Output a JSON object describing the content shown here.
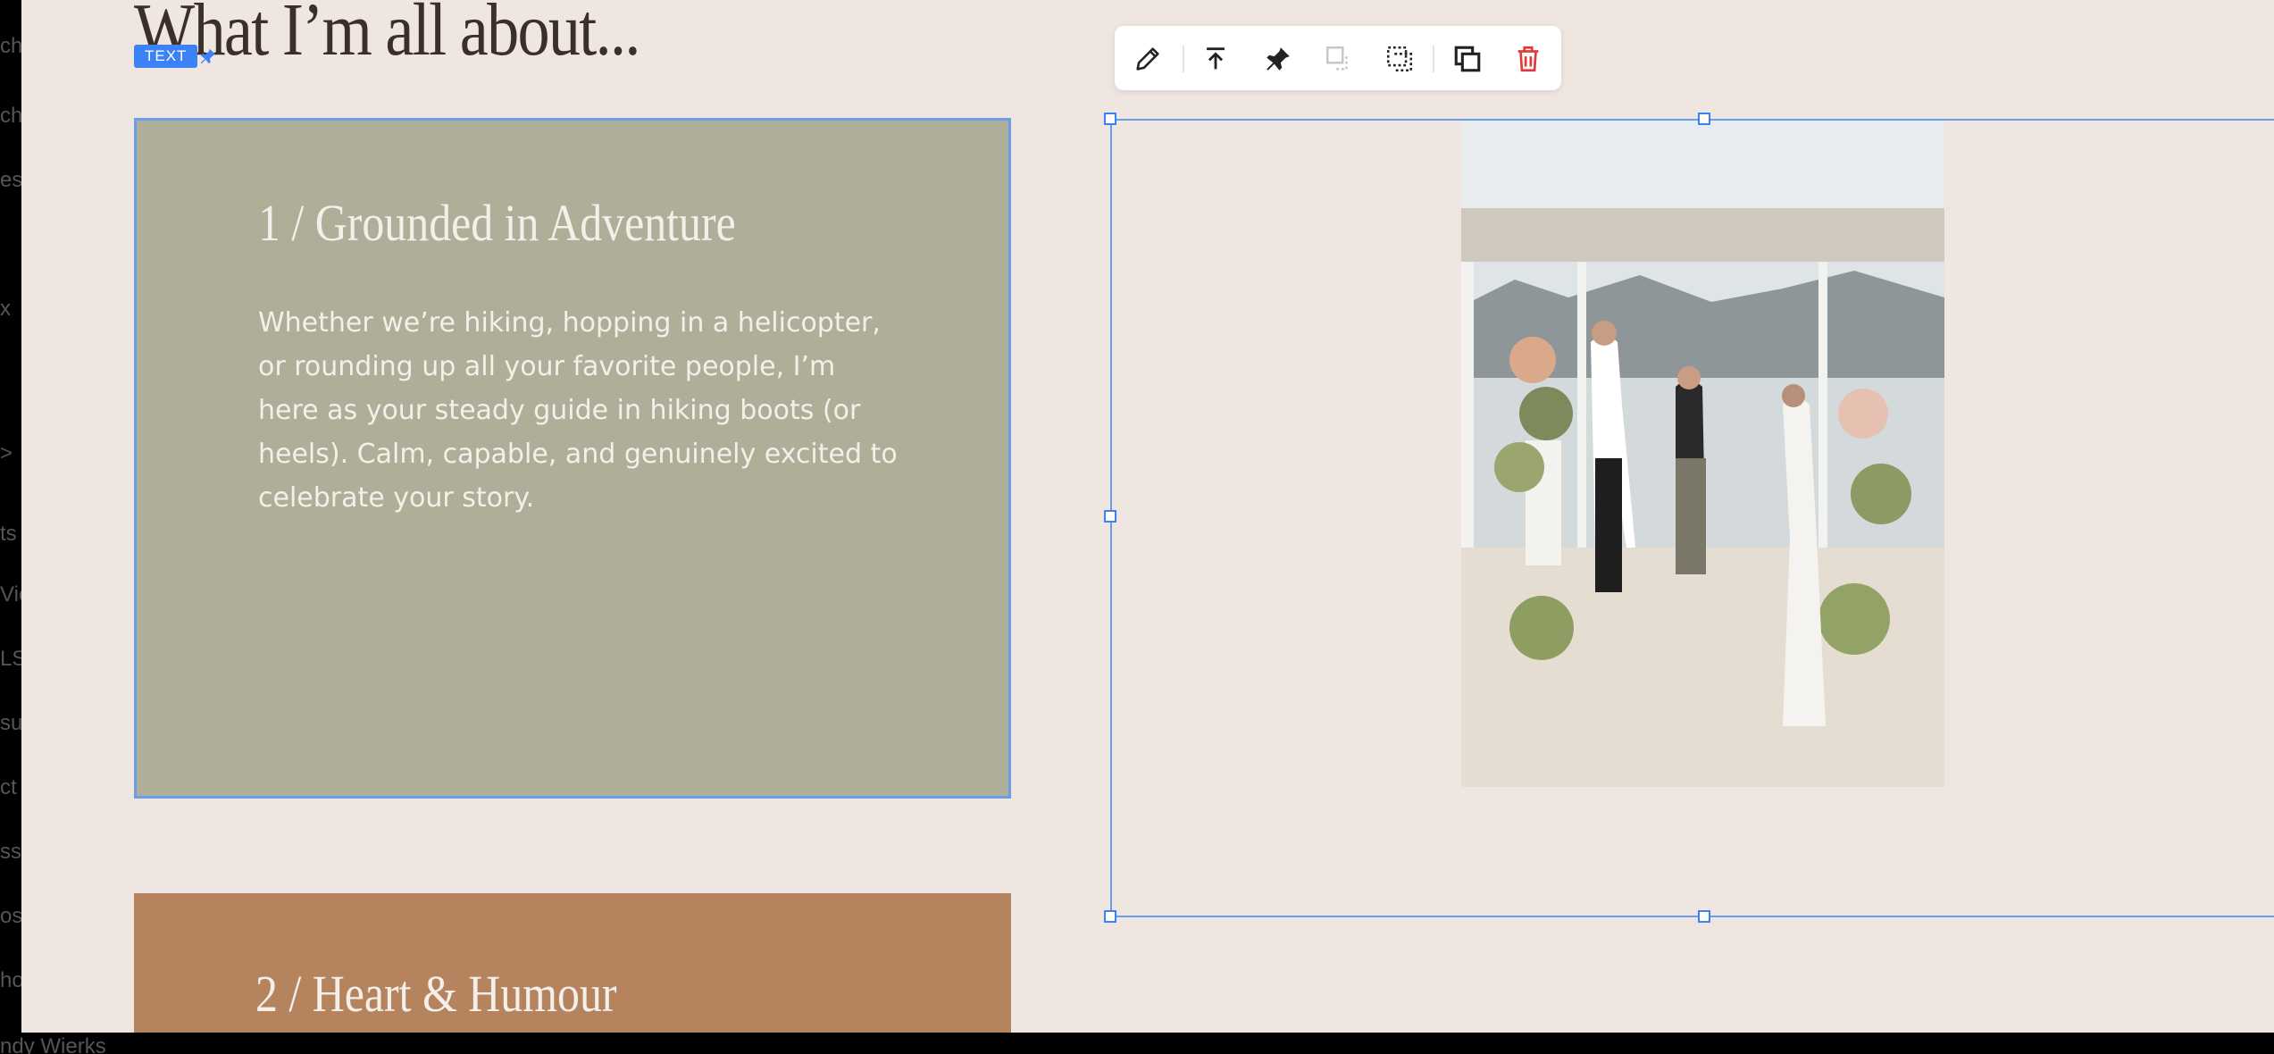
{
  "left_rail": {
    "fragments": [
      "ch",
      "ch",
      "es",
      "x",
      ">",
      "ts",
      "Vic",
      "LS",
      "su",
      "ct",
      "ss",
      "os",
      "ho"
    ]
  },
  "bottom_bar": {
    "name_fragment": "ndy Wierks"
  },
  "section": {
    "heading": "What I’m all about..."
  },
  "selection_tag": {
    "label": "TEXT",
    "icon": "pin-icon"
  },
  "toolbar": {
    "buttons": [
      {
        "name": "edit",
        "icon": "pencil-icon"
      },
      {
        "name": "bring-to-top",
        "icon": "arrow-up-to-line-icon"
      },
      {
        "name": "pin",
        "icon": "pin-icon"
      },
      {
        "name": "group",
        "icon": "group-icon",
        "disabled": true
      },
      {
        "name": "ungroup",
        "icon": "dashed-square-icon"
      },
      {
        "name": "duplicate",
        "icon": "duplicate-icon"
      },
      {
        "name": "delete",
        "icon": "trash-icon"
      }
    ]
  },
  "cards": [
    {
      "title": "1 / Grounded in Adventure",
      "body": "Whether we’re hiking, hopping in a helicopter, or rounding up all your favorite people, I’m here as your steady guide in hiking boots (or heels). Calm, capable, and genuinely excited to celebrate your story.",
      "color": "#afae99"
    },
    {
      "title": "2 / Heart & Humour",
      "color": "#b5845f"
    }
  ],
  "colors": {
    "canvas": "#f0e6e1",
    "selection": "#6b9ee8",
    "accent_blue": "#3b82f6",
    "delete_red": "#e03a3a",
    "heading": "#3b2f2a",
    "card_text": "#f5efe9"
  }
}
